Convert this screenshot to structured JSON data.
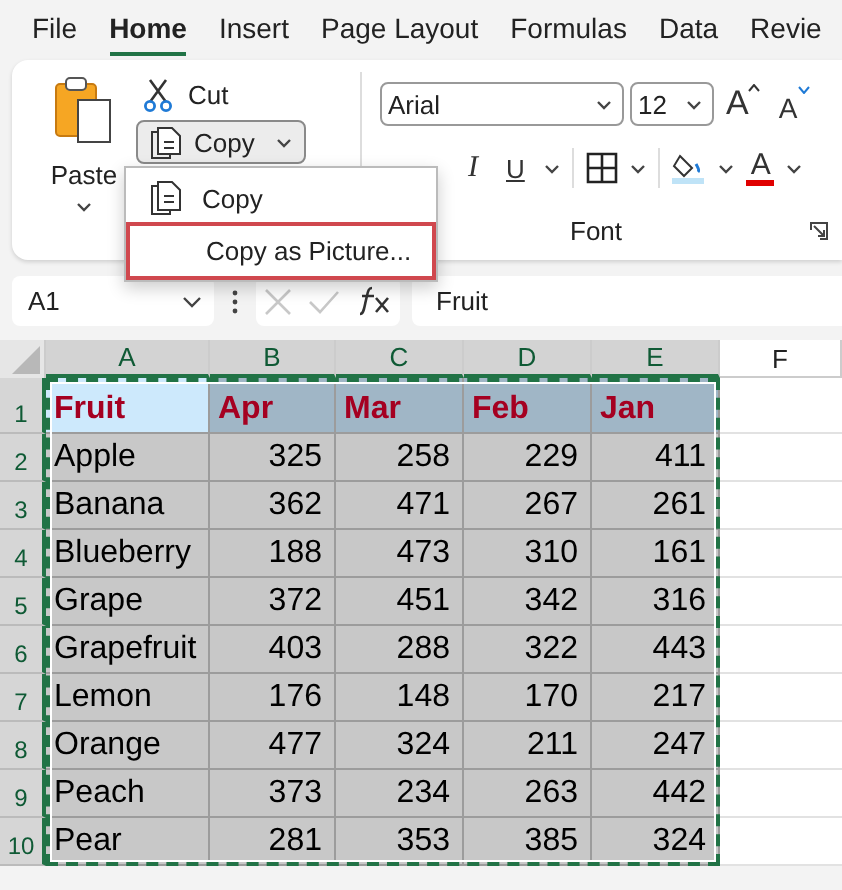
{
  "tabs": [
    {
      "label": "File",
      "selected": false
    },
    {
      "label": "Home",
      "selected": true
    },
    {
      "label": "Insert",
      "selected": false
    },
    {
      "label": "Page Layout",
      "selected": false
    },
    {
      "label": "Formulas",
      "selected": false
    },
    {
      "label": "Data",
      "selected": false
    },
    {
      "label": "Revie",
      "selected": false
    }
  ],
  "clipboard": {
    "paste": "Paste",
    "cut": "Cut",
    "copy": "Copy"
  },
  "font": {
    "name": "Arial",
    "size": "12",
    "grow": "A",
    "shrink": "A",
    "italic": "I",
    "underline": "U",
    "font_color": "A",
    "group_label": "Font"
  },
  "copy_menu": [
    {
      "label": "Copy",
      "kind": "icon",
      "selected": false
    },
    {
      "label": "Copy as Picture...",
      "kind": "plain",
      "selected": true
    }
  ],
  "name_box": "A1",
  "formula": "Fruit",
  "columns": [
    {
      "label": "A",
      "selected": true
    },
    {
      "label": "B",
      "selected": true
    },
    {
      "label": "C",
      "selected": true
    },
    {
      "label": "D",
      "selected": true
    },
    {
      "label": "E",
      "selected": true
    },
    {
      "label": "F",
      "selected": false
    }
  ],
  "rows": [
    {
      "number": "1",
      "kind": "header",
      "cells": [
        {
          "text": "Fruit",
          "active": true
        },
        {
          "text": "Apr",
          "active": false
        },
        {
          "text": "Mar",
          "active": false
        },
        {
          "text": "Feb",
          "active": false
        },
        {
          "text": "Jan",
          "active": false
        }
      ]
    },
    {
      "number": "2",
      "kind": "data",
      "cells": [
        {
          "text": "Apple",
          "active": false
        },
        {
          "text": "325",
          "active": false
        },
        {
          "text": "258",
          "active": false
        },
        {
          "text": "229",
          "active": false
        },
        {
          "text": "411",
          "active": false
        }
      ]
    },
    {
      "number": "3",
      "kind": "data",
      "cells": [
        {
          "text": "Banana",
          "active": false
        },
        {
          "text": "362",
          "active": false
        },
        {
          "text": "471",
          "active": false
        },
        {
          "text": "267",
          "active": false
        },
        {
          "text": "261",
          "active": false
        }
      ]
    },
    {
      "number": "4",
      "kind": "data",
      "cells": [
        {
          "text": "Blueberry",
          "active": false
        },
        {
          "text": "188",
          "active": false
        },
        {
          "text": "473",
          "active": false
        },
        {
          "text": "310",
          "active": false
        },
        {
          "text": "161",
          "active": false
        }
      ]
    },
    {
      "number": "5",
      "kind": "data",
      "cells": [
        {
          "text": "Grape",
          "active": false
        },
        {
          "text": "372",
          "active": false
        },
        {
          "text": "451",
          "active": false
        },
        {
          "text": "342",
          "active": false
        },
        {
          "text": "316",
          "active": false
        }
      ]
    },
    {
      "number": "6",
      "kind": "data",
      "cells": [
        {
          "text": "Grapefruit",
          "active": false
        },
        {
          "text": "403",
          "active": false
        },
        {
          "text": "288",
          "active": false
        },
        {
          "text": "322",
          "active": false
        },
        {
          "text": "443",
          "active": false
        }
      ]
    },
    {
      "number": "7",
      "kind": "data",
      "cells": [
        {
          "text": "Lemon",
          "active": false
        },
        {
          "text": "176",
          "active": false
        },
        {
          "text": "148",
          "active": false
        },
        {
          "text": "170",
          "active": false
        },
        {
          "text": "217",
          "active": false
        }
      ]
    },
    {
      "number": "8",
      "kind": "data",
      "cells": [
        {
          "text": "Orange",
          "active": false
        },
        {
          "text": "477",
          "active": false
        },
        {
          "text": "324",
          "active": false
        },
        {
          "text": "211",
          "active": false
        },
        {
          "text": "247",
          "active": false
        }
      ]
    },
    {
      "number": "9",
      "kind": "data",
      "cells": [
        {
          "text": "Peach",
          "active": false
        },
        {
          "text": "373",
          "active": false
        },
        {
          "text": "234",
          "active": false
        },
        {
          "text": "263",
          "active": false
        },
        {
          "text": "442",
          "active": false
        }
      ]
    },
    {
      "number": "10",
      "kind": "data",
      "cells": [
        {
          "text": "Pear",
          "active": false
        },
        {
          "text": "281",
          "active": false
        },
        {
          "text": "353",
          "active": false
        },
        {
          "text": "385",
          "active": false
        },
        {
          "text": "324",
          "active": false
        }
      ]
    }
  ]
}
